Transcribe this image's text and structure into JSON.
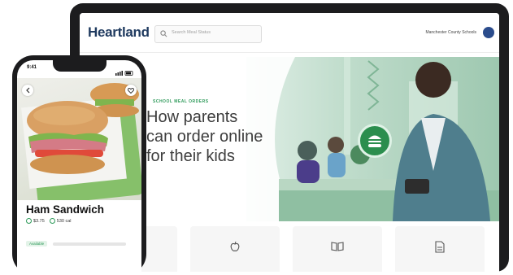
{
  "laptop": {
    "brand": "Heartland",
    "search": {
      "placeholder": "Search Meal Status"
    },
    "district": "Manchester County Schools",
    "hero": {
      "eyebrow": "SCHOOL MEAL ORDERS",
      "title_lines": [
        "How parents",
        "can order online",
        "for their kids"
      ]
    },
    "cards": [
      {
        "icon": "blank-icon"
      },
      {
        "icon": "apple-icon"
      },
      {
        "icon": "book-icon"
      },
      {
        "icon": "document-icon"
      }
    ]
  },
  "phone": {
    "status_time": "9:41",
    "item": {
      "title": "Ham Sandwich",
      "price": "$3.75",
      "calories": "530 cal",
      "tag": "Available"
    }
  },
  "colors": {
    "brand_green": "#2e9a5a",
    "brand_navy": "#1f3a5f",
    "device_frame": "#1c1c1e"
  }
}
